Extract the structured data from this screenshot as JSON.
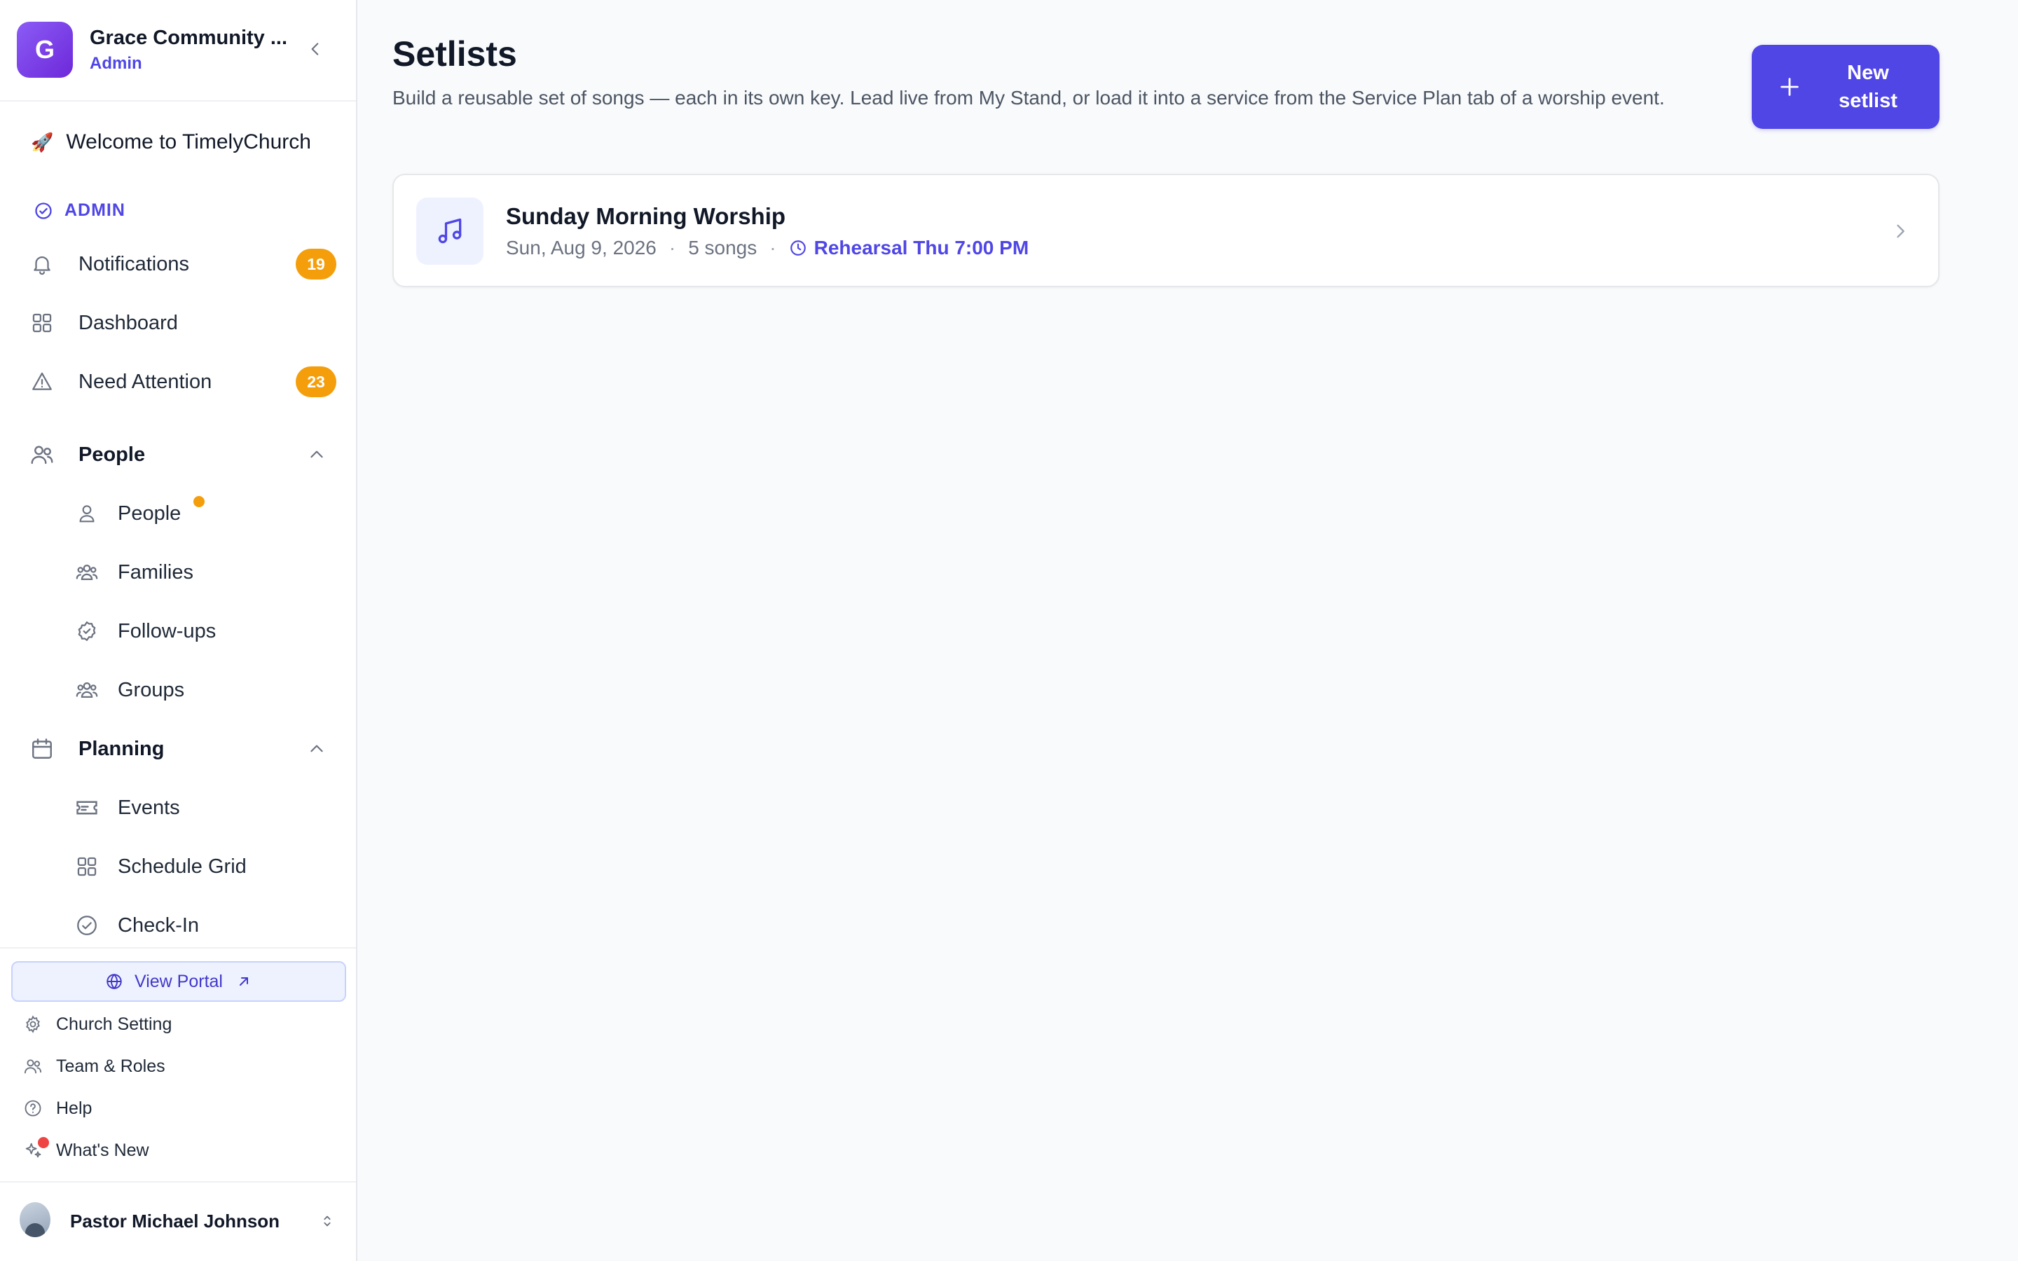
{
  "org": {
    "initial": "G",
    "name": "Grace Community ...",
    "role": "Admin"
  },
  "sidebar": {
    "welcome_emoji": "🚀",
    "welcome": "Welcome to TimelyChurch",
    "admin_label": "ADMIN",
    "notifications": {
      "label": "Notifications",
      "count": "19"
    },
    "dashboard": "Dashboard",
    "need_attention": {
      "label": "Need Attention",
      "count": "23"
    },
    "people_section": "People",
    "people_items": [
      "People",
      "Families",
      "Follow-ups",
      "Groups"
    ],
    "planning_section": "Planning",
    "planning_items": [
      "Events",
      "Schedule Grid",
      "Check-In"
    ],
    "view_portal": "View Portal",
    "utilities": [
      "Church Setting",
      "Team & Roles",
      "Help",
      "What's New"
    ]
  },
  "user": {
    "name": "Pastor Michael Johnson"
  },
  "main": {
    "title": "Setlists",
    "description": "Build a reusable set of songs — each in its own key. Lead live from My Stand, or load it into a service from the Service Plan tab of a worship event.",
    "new_button": "New setlist",
    "setlists": [
      {
        "title": "Sunday Morning Worship",
        "date": "Sun, Aug 9, 2026",
        "songs": "5 songs",
        "rehearsal": "Rehearsal Thu 7:00 PM"
      }
    ]
  },
  "colors": {
    "accent": "#4f46e5",
    "badge": "#f59e0b",
    "alert_dot": "#ef4444"
  }
}
